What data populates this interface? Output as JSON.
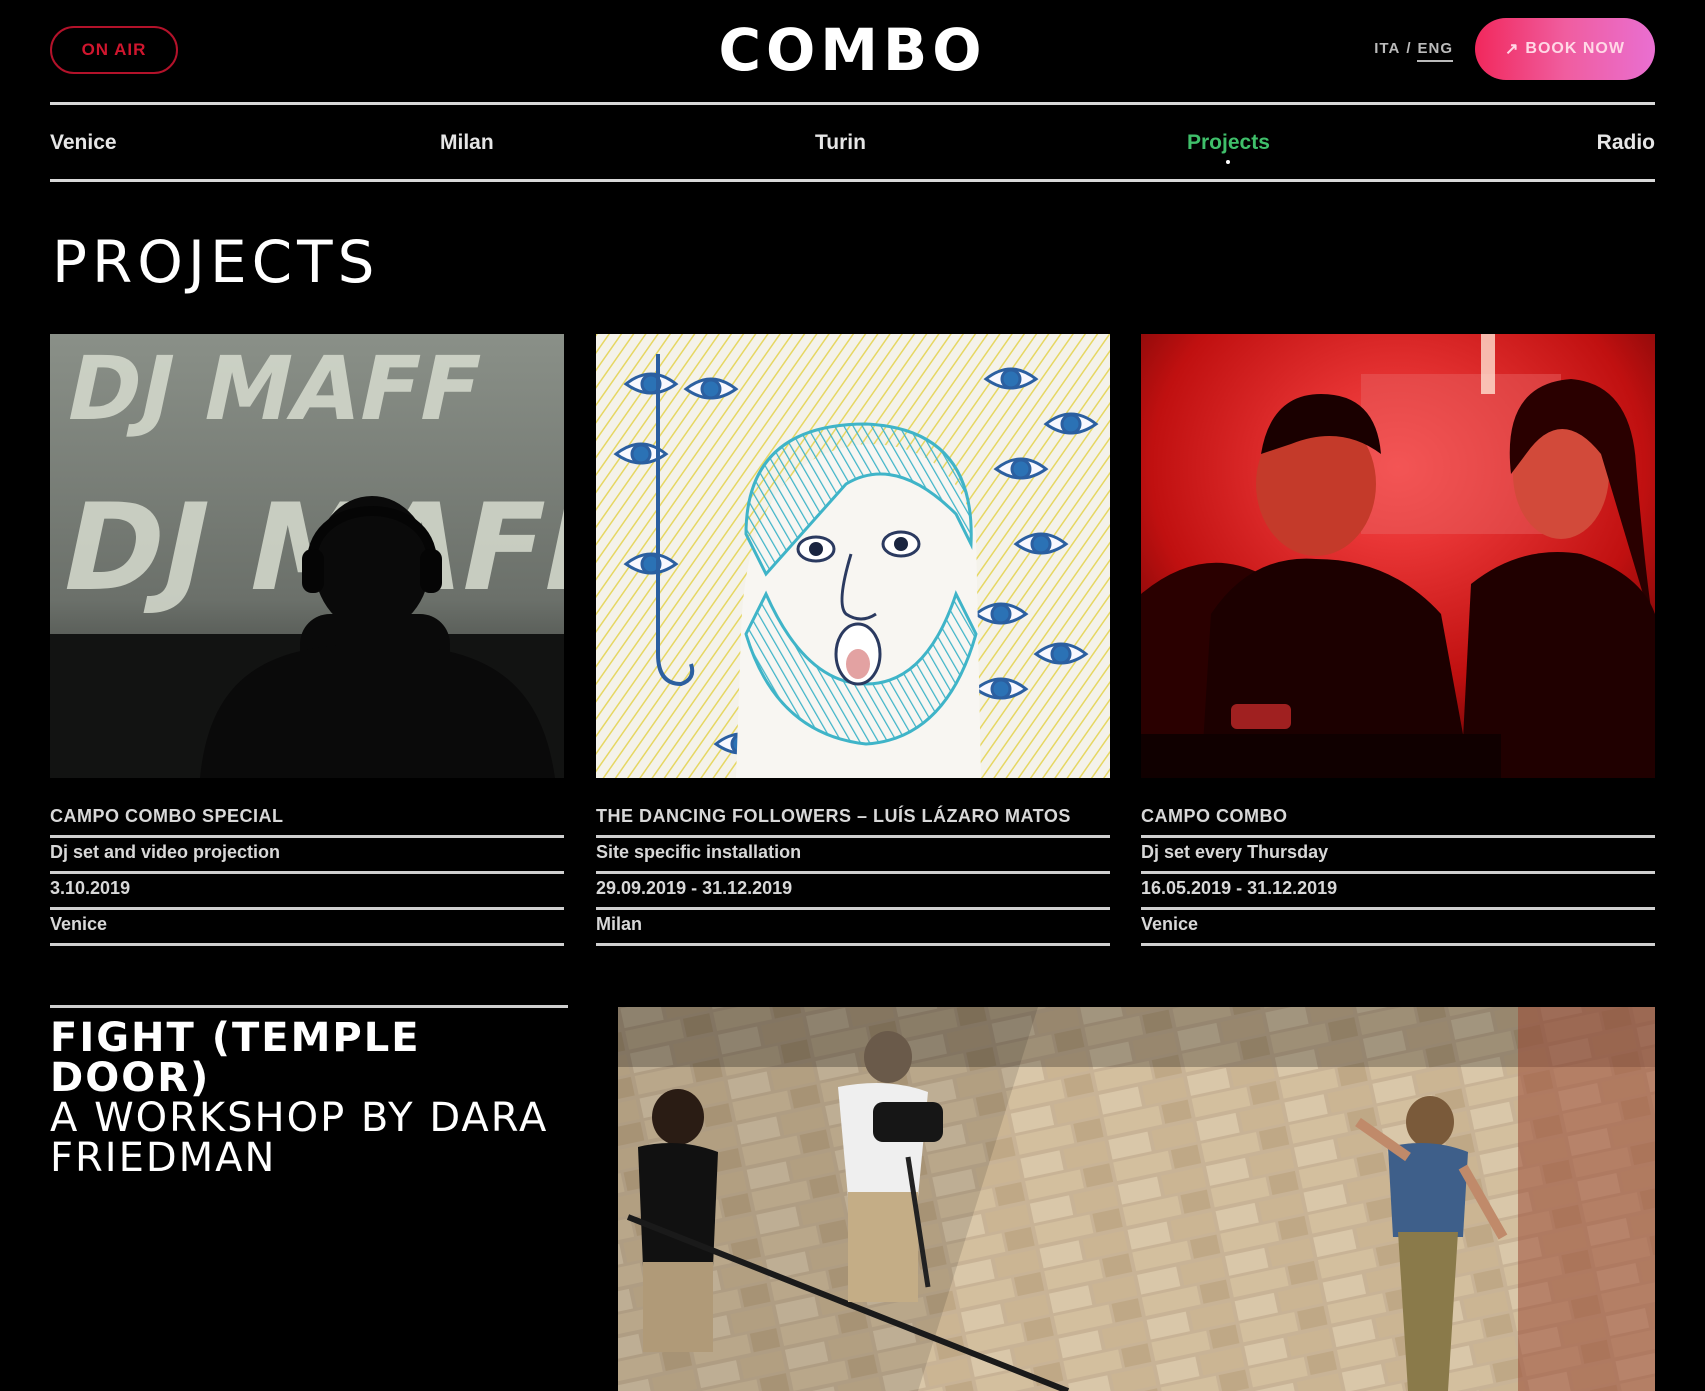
{
  "header": {
    "on_air": "ON AIR",
    "logo": "COMBO",
    "lang_ita": "ITA",
    "lang_sep": "/",
    "lang_eng": "ENG",
    "book_arrow": "↗",
    "book_label": "BOOK NOW"
  },
  "nav": {
    "items": [
      {
        "label": "Venice"
      },
      {
        "label": "Milan"
      },
      {
        "label": "Turin"
      },
      {
        "label": "Projects"
      },
      {
        "label": "Radio"
      }
    ]
  },
  "page_title": "PROJECTS",
  "projects": [
    {
      "title": "CAMPO COMBO SPECIAL",
      "type": "Dj set and video projection",
      "date": "3.10.2019",
      "city": "Venice"
    },
    {
      "title": "THE DANCING FOLLOWERS – LUÍS LÁZARO MATOS",
      "type": "Site specific installation",
      "date": "29.09.2019 - 31.12.2019",
      "city": "Milan"
    },
    {
      "title": "CAMPO COMBO",
      "type": "Dj set every Thursday",
      "date": "16.05.2019 - 31.12.2019",
      "city": "Venice"
    }
  ],
  "projection_text": {
    "line1": "DJ MAFF",
    "line2": "DJ MAFF"
  },
  "feature": {
    "title": "FIGHT (TEMPLE DOOR)",
    "subtitle": "A WORKSHOP BY DARA FRIEDMAN"
  },
  "colors": {
    "background": "#000000",
    "accent_green": "#3fbf6a",
    "on_air_red": "#d0162e",
    "book_gradient_start": "#f1285c",
    "book_gradient_end": "#e96fd1"
  }
}
